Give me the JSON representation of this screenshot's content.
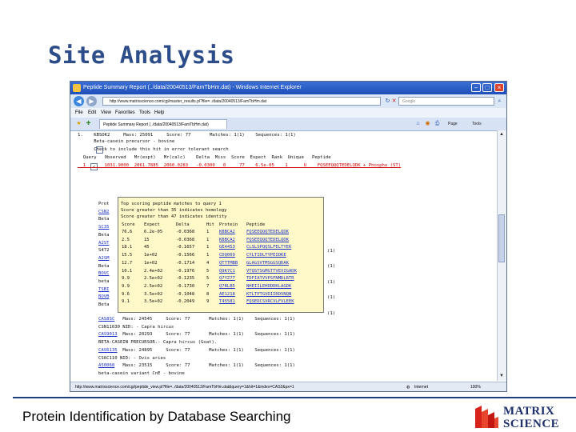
{
  "slide": {
    "title": "Site Analysis",
    "footer": "Protein Identification by Database Searching",
    "logo_line1": "MATRIX",
    "logo_line2": "SCIENCE"
  },
  "browser": {
    "window_title": "Peptide Summary Report (../data/20040513/FamTbHm.dat) - Windows Internet Explorer",
    "address": "http://www.matrixscience.com/cgi/master_results.pl?file=../data/20040513/FamTbHm.dat",
    "search_placeholder": "Google",
    "menu": [
      "File",
      "Edit",
      "View",
      "Favorites",
      "Tools",
      "Help"
    ],
    "tab_label": "Peptide Summary Report (../data/20040513/FamTbHm.dat)",
    "toolbar": {
      "page": "Page",
      "tools": "Tools"
    },
    "status_left": "http://www.matrixscience.com/cgi/peptide_view.pl?file=../data/20040513/FamTbHm.dat&query=1&hit=1&index=CAS2&px=1",
    "status_zone": "Internet",
    "status_zoom": "100%"
  },
  "report": {
    "lines": [
      "1.    KBSOK2     Mass: 25091     Score: 77       Matches: 1(1)    Sequences: 1(1)",
      "      Beta-casein precursor - bovine",
      "      Check to include this hit in error tolerant search",
      "  Query   Observed   Mr(expt)   Mr(calc)    Delta  Miss  Score  Expect  Rank  Unique   Peptide",
      "  1       1031.9000  2061.7885  2060.0283   -0.0300   0     77    6.5e-05    1      U    FQSEEQQQTEDELQDK + Phospho (ST)"
    ],
    "side_lines": [
      {
        "text": "Prot",
        "link": false
      },
      {
        "text": "CSN2",
        "link": true
      },
      {
        "text": "Beta",
        "link": false
      },
      {
        "text": "SC35",
        "link": true
      },
      {
        "text": "Beta",
        "link": false
      },
      {
        "text": "A2ST",
        "link": true
      },
      {
        "text": "S472",
        "link": false
      },
      {
        "text": "A2SM",
        "link": true
      },
      {
        "text": "Beta",
        "link": false
      },
      {
        "text": "BOVC",
        "link": true
      },
      {
        "text": "beta",
        "link": false
      },
      {
        "text": "TSBI",
        "link": true
      },
      {
        "text": "BOVB",
        "link": true
      },
      {
        "text": "Beta",
        "link": false
      }
    ],
    "side_matches": [
      "(1)",
      "(1)",
      "(1)",
      "(1)",
      "(1)"
    ],
    "lower_lines": [
      {
        "acc": "CAS8SC",
        "rest": "   Mass: 24545     Score: 77       Matches: 1(1)    Sequences: 1(1)"
      },
      {
        "acc": "",
        "rest": "CSN11030 NID: - Capra hircus"
      },
      {
        "acc": "CAS9013",
        "rest": "  Mass: 20293     Score: 77       Matches: 1(1)    Sequences: 1(1)"
      },
      {
        "acc": "",
        "rest": "BETA-CASEIN PRECURSOR.- Capra hircus (Goat)."
      },
      {
        "acc": "CAS6135",
        "rest": "  Mass: 24895     Score: 77       Matches: 1(1)    Sequences: 1(1)"
      },
      {
        "acc": "",
        "rest": "CS6C110 NID: - Ovis aries"
      },
      {
        "acc": "A50068",
        "rest": "   Mass: 23515     Score: 77       Matches: 1(1)    Sequences: 1(1)"
      },
      {
        "acc": "",
        "rest": "beta-casein variant CnE - bovine"
      }
    ]
  },
  "popup": {
    "header": [
      "Top scoring peptide matches to query 1",
      "Score greater than 35 indicates homology",
      "Score greater than 47 indicates identity"
    ],
    "columns": [
      "Score",
      "Expect",
      "Delta",
      "Hit",
      "Protein",
      "Peptide"
    ],
    "rows": [
      [
        "76.6",
        "6.2e-05",
        "-0.0368",
        "1",
        "KBBCA2",
        "FQSEEQQQTEDELQDK"
      ],
      [
        "2.5",
        "15",
        "-0.0368",
        "1",
        "KBBCA2",
        "FQSEEQQQTEDELQDK"
      ],
      [
        "18.1",
        "45",
        "-0.1657",
        "1",
        "GE4453",
        "CLSLSPQQSLFELTYEK"
      ],
      [
        "15.5",
        "1e+02",
        "-0.1566",
        "1",
        "CDQ069",
        "CYLTIDLTYPEIDKE"
      ],
      [
        "12.7",
        "1e+02",
        "-0.1714",
        "4",
        "QTTTMBB",
        "GLAGSVTMSGGSQDAK"
      ],
      [
        "10.1",
        "2.4e+02",
        "-0.1976",
        "5",
        "Q9K7C1",
        "VTQSTSGMGTTVEVIGADK"
      ],
      [
        "9.9",
        "2.5e+02",
        "-0.1235",
        "5",
        "Q7YZ77",
        "TDFIATVVPSFNMDLRTR"
      ],
      [
        "9.9",
        "2.5e+02",
        "-0.1730",
        "7",
        "Q7RLB5",
        "NHEIILEHDDDKLAGDK"
      ],
      [
        "9.6",
        "3.5e+02",
        "-0.1048",
        "8",
        "AE1218",
        "KTLTPTGVDIIRDVNQN"
      ],
      [
        "9.1",
        "3.5e+02",
        "-0.2049",
        "9",
        "T45581",
        "FQSEDCSVRCVLFVLEEK"
      ]
    ]
  }
}
